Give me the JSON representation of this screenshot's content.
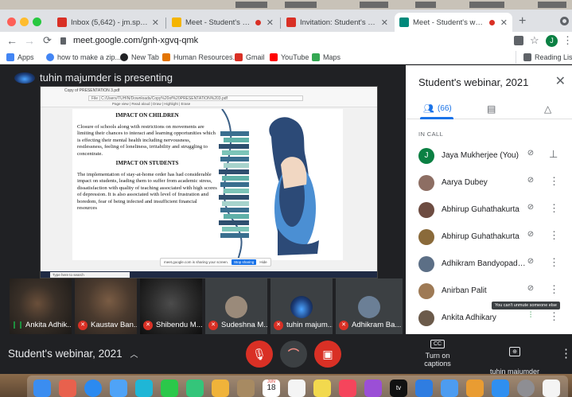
{
  "browser": {
    "tabs": [
      {
        "label": "Inbox (5,642) - jm.spcmc@gm",
        "favicon_color": "#d93025"
      },
      {
        "label": "Meet - Student's webinar",
        "favicon_color": "#f4b400",
        "recording": true
      },
      {
        "label": "Invitation: Student's webinar, 2",
        "favicon_color": "#d93025"
      },
      {
        "label": "Meet - Student's webinar",
        "favicon_color": "#00897b",
        "recording": true,
        "active": true
      }
    ],
    "new_tab": "+",
    "url": "meet.google.com/gnh-xgvq-qmk",
    "bookmarks": [
      {
        "label": "Apps",
        "color": "#4285f4"
      },
      {
        "label": "how to make a zip...",
        "color": "#4285f4"
      },
      {
        "label": "New Tab",
        "color": "#202124"
      },
      {
        "label": "Human Resources...",
        "color": "#e37400"
      },
      {
        "label": "Gmail",
        "color": "#d93025"
      },
      {
        "label": "YouTube",
        "color": "#ff0000"
      },
      {
        "label": "Maps",
        "color": "#34a853"
      }
    ],
    "reading_list": "Reading List",
    "profile_initial": "J"
  },
  "stage": {
    "presenter_label": "tuhin majumder is presenting",
    "pdf": {
      "tab_title": "Copy of PRESENTATION 3.pdf",
      "path": "File | C:/Users/TUHIN/Downloads/Copy%20of%20PRESENTATION%203.pdf",
      "toolbar": "Page view | Read aloud | Draw | Highlight | Erase"
    },
    "doc": {
      "heading_children": "IMPACT ON CHILDREN",
      "para_children": "Closure of schools along with restrictions on movements are limiting their chances to interact and learning opportunities which is effecting their mental health including nervousness, restlessness, feeling of loneliness, irritability and struggling to concentrate.",
      "heading_students": "IMPACT ON STUDENTS",
      "para_students": "The implementation of stay-at-home order has had considerable impact on students, leading them to suffer from academic stress, dissatisfaction with quality of teaching associated with high scores of depression. It is also associated with level of frustration and boredom, fear of being infected and insufficient financial resources"
    },
    "share_pill": {
      "text": "meet.google.com is sharing your screen.",
      "stop": "Stop sharing",
      "hide": "Hide"
    },
    "taskbar_search": "Type here to search"
  },
  "tiles": [
    {
      "name": "Ankita Adhik...",
      "muted": false,
      "type": "video"
    },
    {
      "name": "Kaustav Ban...",
      "muted": true,
      "type": "video"
    },
    {
      "name": "Shibendu M...",
      "muted": true,
      "type": "video"
    },
    {
      "name": "Sudeshna M...",
      "muted": true,
      "type": "avatar"
    },
    {
      "name": "tuhin majum...",
      "muted": true,
      "type": "logo"
    },
    {
      "name": "Adhikram Ba...",
      "muted": true,
      "type": "avatar"
    }
  ],
  "controls": {
    "meeting_name": "Student's webinar, 2021",
    "captions_label": "Turn on captions",
    "captions_icon": "CC",
    "presenting_label": "tuhin majumder\nis presenting"
  },
  "panel": {
    "title": "Student's webinar, 2021",
    "people_count": "(66)",
    "section": "IN CALL",
    "participants": [
      {
        "name": "Jaya Mukherjee (You)",
        "initial": "J",
        "color": "#0b8043",
        "pin": true
      },
      {
        "name": "Aarya Dubey",
        "color": "#8d6e63"
      },
      {
        "name": "Abhirup Guhathakurta",
        "color": "#6d4c41"
      },
      {
        "name": "Abhirup Guhathakurta",
        "color": "#8a6a3a"
      },
      {
        "name": "Adhikram Bandyopadhy...",
        "color": "#5c6f86"
      },
      {
        "name": "Anirban Palit",
        "color": "#9e7a55"
      },
      {
        "name": "Ankita Adhikary",
        "color": "#6b5a4a",
        "speaking": true
      }
    ],
    "tooltip": "You can't unmute someone else"
  },
  "dock": {
    "calendar_month": "JUN",
    "calendar_day": "18",
    "tv_label": "tv"
  },
  "colors": {
    "accent": "#1a73e8",
    "danger": "#d93025",
    "meet_bg": "#202124",
    "speaking": "#1e8e3e"
  }
}
